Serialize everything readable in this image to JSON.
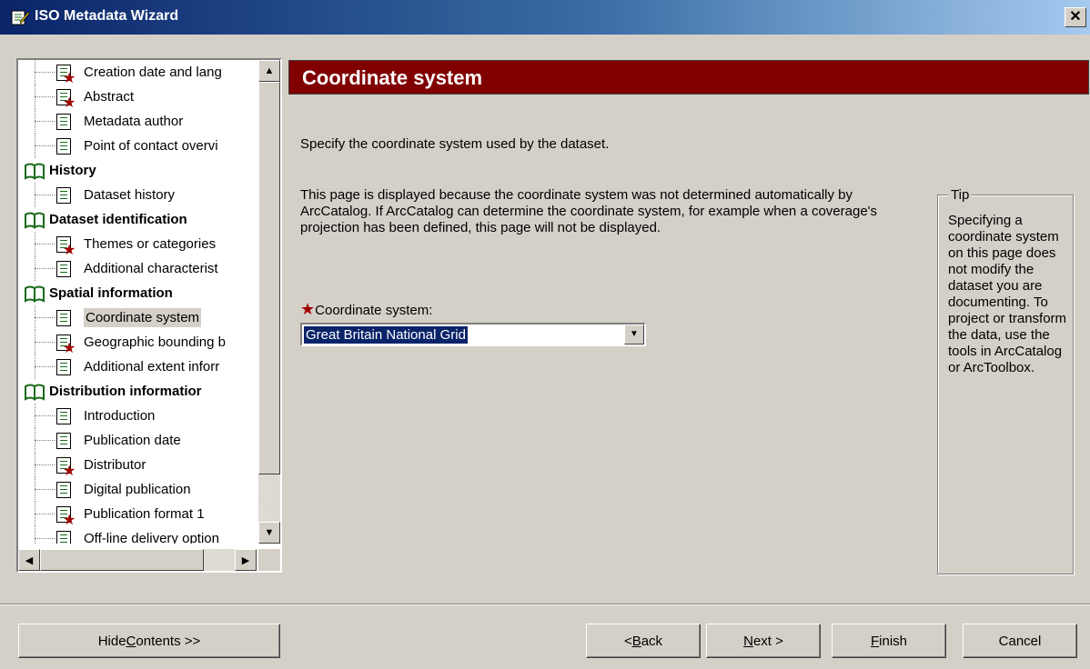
{
  "window": {
    "title": "ISO Metadata Wizard",
    "close_glyph": "✕"
  },
  "tree": {
    "items": [
      {
        "label": "Creation date and lang",
        "type": "child",
        "required": true
      },
      {
        "label": "Abstract",
        "type": "child",
        "required": true
      },
      {
        "label": "Metadata author",
        "type": "child",
        "required": false
      },
      {
        "label": "Point of contact overvi",
        "type": "child",
        "required": false
      },
      {
        "label": "History",
        "type": "group"
      },
      {
        "label": "Dataset history",
        "type": "child",
        "required": false
      },
      {
        "label": "Dataset identification",
        "type": "group"
      },
      {
        "label": "Themes or categories",
        "type": "child",
        "required": true
      },
      {
        "label": "Additional characterist",
        "type": "child",
        "required": false
      },
      {
        "label": "Spatial information",
        "type": "group"
      },
      {
        "label": "Coordinate system",
        "type": "child",
        "required": false,
        "selected": true
      },
      {
        "label": "Geographic bounding b",
        "type": "child",
        "required": true
      },
      {
        "label": "Additional extent inforr",
        "type": "child",
        "required": false
      },
      {
        "label": "Distribution informatior",
        "type": "group"
      },
      {
        "label": "Introduction",
        "type": "child",
        "required": false
      },
      {
        "label": "Publication date",
        "type": "child",
        "required": false
      },
      {
        "label": "Distributor",
        "type": "child",
        "required": true
      },
      {
        "label": "Digital publication",
        "type": "child",
        "required": false
      },
      {
        "label": "Publication format 1",
        "type": "child",
        "required": true
      },
      {
        "label": "Off-line delivery option",
        "type": "child",
        "required": false
      }
    ]
  },
  "page": {
    "heading": "Coordinate system",
    "description": "Specify the coordinate system used by the dataset.",
    "paragraph": "This page is displayed because the coordinate system was not determined automatically by ArcCatalog.  If ArcCatalog can determine the coordinate system, for example when a coverage's projection has been defined, this page will not be displayed.",
    "field_label": "Coordinate system:",
    "field_value": "Great Britain National Grid"
  },
  "tip": {
    "title": "Tip",
    "text": "Specifying a coordinate system on this page does not modify the dataset you are documenting. To project or transform the data, use the tools in ArcCatalog or ArcToolbox."
  },
  "buttons": {
    "hide_contents_pre": "Hide ",
    "hide_contents_key": "C",
    "hide_contents_post": "ontents >>",
    "back_pre": "< ",
    "back_key": "B",
    "back_post": "ack",
    "next_key": "N",
    "next_post": "ext >",
    "finish_key": "F",
    "finish_post": "inish",
    "cancel": "Cancel"
  }
}
